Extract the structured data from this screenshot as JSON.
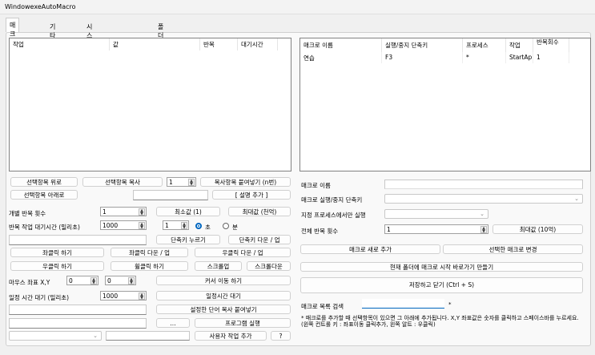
{
  "window": {
    "title": "WindowexeAutoMacro"
  },
  "tabs": [
    "매크로 작업",
    "기타 설정",
    "시스템 종료 절전 깨우기",
    "폴더 모니터링"
  ],
  "task_list": {
    "columns": [
      "작업",
      "값",
      "반복",
      "대기시간"
    ]
  },
  "left": {
    "move_up": "선택항목 위로",
    "copy": "선택항목 복사",
    "paste_count": "1",
    "paste_n": "복사항목 붙여넣기 (n번)",
    "move_down": "선택항목 아래로",
    "desc_input": "",
    "add_desc": "[ 설명 추가 ]",
    "repeat_label": "개별 반복 횟수",
    "repeat_value": "1",
    "min": "최소값 (1)",
    "max": "최대값 (천억)",
    "wait_label": "반복 작업 대기시간 (밀리초)",
    "wait_value": "1000",
    "unit_value": "1",
    "sec": "초",
    "min_unit": "분",
    "hotkey_input": "",
    "hotkey_press": "단축키 누르기",
    "hotkey_downup": "단축키 다운 / 업",
    "lclick": "좌클릭 하기",
    "lclick_downup": "좌클릭 다운 / 업",
    "rclick_downup": "우클릭 다운 / 업",
    "rclick": "우클릭 하기",
    "wheel": "휠클릭 하기",
    "scroll_up": "스크롤업",
    "scroll_down": "스크롤다운",
    "xy_label": "마우스 좌표 X,Y",
    "x": "0",
    "y": "0",
    "move_cursor": "커서 이동 하기",
    "delay_label": "일정 시간 대기 (밀리초)",
    "delay_value": "1000",
    "delay_btn": "일정시간 대기",
    "paste_word": "설정한 단어 복사 붙여넣기",
    "browse": "...",
    "run_program": "프로그램 실행",
    "custom_add": "사용자 작업 추가",
    "help": "?"
  },
  "macro_list": {
    "columns": [
      "매크로 이름",
      "실행/중지 단축키",
      "프로세스",
      "작업",
      "반복회수"
    ],
    "rows": [
      [
        "연습",
        "F3",
        "*",
        "StartAp...",
        "1"
      ]
    ]
  },
  "right": {
    "name_label": "매크로 이름",
    "hotkey_label": "매크로 실행/중지 단축키",
    "process_label": "지정 프로세스에서만 실행",
    "total_label": "전체 반복 횟수",
    "total_value": "1",
    "total_max": "최대값 (10억)",
    "add": "매크로 새로 추가",
    "change": "선택한 매크로 변경",
    "shortcut": "현재 폴더에 매크로 시작 바로가기 만들기",
    "save": "저장하고 닫기 (Ctrl + S)",
    "search_label": "매크로 목록 검색",
    "search_mark": "*",
    "note": "* 매크로를 추가할 때 선택항목이 있으면 그 아래에 추가됩니다. X,Y 좌표값은 숫자를 클릭하고 스페이스바를 누르세요. (왼쪽 컨트롤 키 : 좌표이동 클릭추가, 왼쪽 알트 : 우클릭)"
  }
}
